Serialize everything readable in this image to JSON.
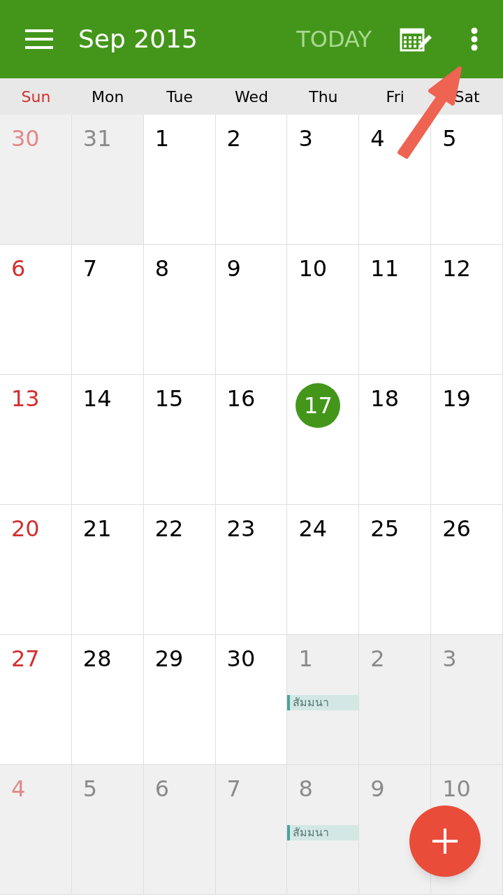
{
  "header": {
    "title": "Sep 2015",
    "today_button": "TODAY"
  },
  "weekdays": [
    "Sun",
    "Mon",
    "Tue",
    "Wed",
    "Thu",
    "Fri",
    "Sat"
  ],
  "weeks": [
    [
      {
        "day": "30",
        "in_month": false,
        "today": false
      },
      {
        "day": "31",
        "in_month": false,
        "today": false
      },
      {
        "day": "1",
        "in_month": true,
        "today": false
      },
      {
        "day": "2",
        "in_month": true,
        "today": false
      },
      {
        "day": "3",
        "in_month": true,
        "today": false
      },
      {
        "day": "4",
        "in_month": true,
        "today": false
      },
      {
        "day": "5",
        "in_month": true,
        "today": false
      }
    ],
    [
      {
        "day": "6",
        "in_month": true,
        "today": false
      },
      {
        "day": "7",
        "in_month": true,
        "today": false
      },
      {
        "day": "8",
        "in_month": true,
        "today": false
      },
      {
        "day": "9",
        "in_month": true,
        "today": false
      },
      {
        "day": "10",
        "in_month": true,
        "today": false
      },
      {
        "day": "11",
        "in_month": true,
        "today": false
      },
      {
        "day": "12",
        "in_month": true,
        "today": false
      }
    ],
    [
      {
        "day": "13",
        "in_month": true,
        "today": false
      },
      {
        "day": "14",
        "in_month": true,
        "today": false
      },
      {
        "day": "15",
        "in_month": true,
        "today": false
      },
      {
        "day": "16",
        "in_month": true,
        "today": false
      },
      {
        "day": "17",
        "in_month": true,
        "today": true
      },
      {
        "day": "18",
        "in_month": true,
        "today": false
      },
      {
        "day": "19",
        "in_month": true,
        "today": false
      }
    ],
    [
      {
        "day": "20",
        "in_month": true,
        "today": false
      },
      {
        "day": "21",
        "in_month": true,
        "today": false
      },
      {
        "day": "22",
        "in_month": true,
        "today": false
      },
      {
        "day": "23",
        "in_month": true,
        "today": false
      },
      {
        "day": "24",
        "in_month": true,
        "today": false
      },
      {
        "day": "25",
        "in_month": true,
        "today": false
      },
      {
        "day": "26",
        "in_month": true,
        "today": false
      }
    ],
    [
      {
        "day": "27",
        "in_month": true,
        "today": false
      },
      {
        "day": "28",
        "in_month": true,
        "today": false
      },
      {
        "day": "29",
        "in_month": true,
        "today": false
      },
      {
        "day": "30",
        "in_month": true,
        "today": false
      },
      {
        "day": "1",
        "in_month": false,
        "today": false,
        "events": [
          "สัมมนา"
        ]
      },
      {
        "day": "2",
        "in_month": false,
        "today": false
      },
      {
        "day": "3",
        "in_month": false,
        "today": false
      }
    ],
    [
      {
        "day": "4",
        "in_month": false,
        "today": false
      },
      {
        "day": "5",
        "in_month": false,
        "today": false
      },
      {
        "day": "6",
        "in_month": false,
        "today": false
      },
      {
        "day": "7",
        "in_month": false,
        "today": false
      },
      {
        "day": "8",
        "in_month": false,
        "today": false,
        "events": [
          "สัมมนา"
        ]
      },
      {
        "day": "9",
        "in_month": false,
        "today": false
      },
      {
        "day": "10",
        "in_month": false,
        "today": false
      }
    ]
  ]
}
